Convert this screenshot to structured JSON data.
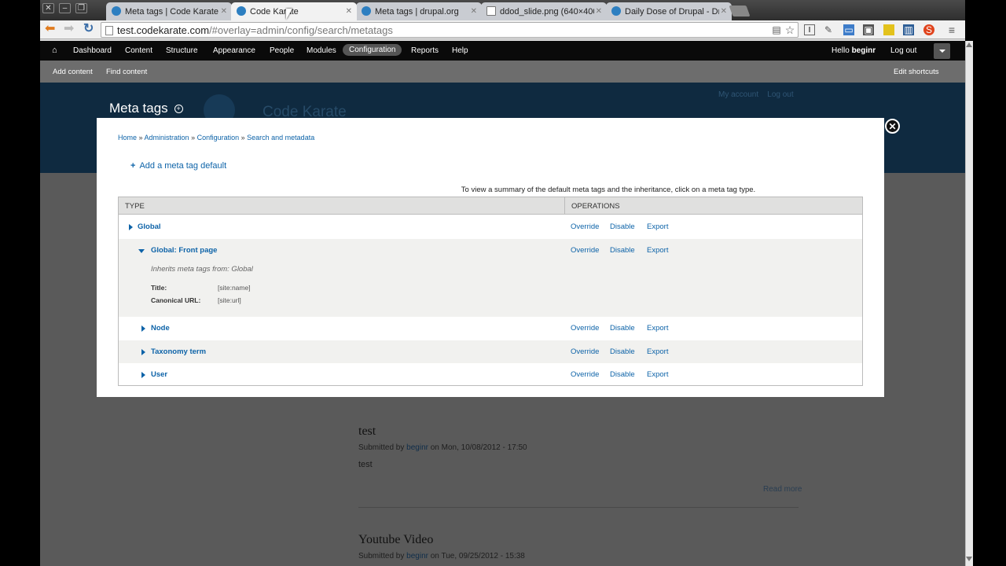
{
  "browser": {
    "tabs": [
      {
        "title": "Meta tags | Code Karate",
        "icon": "drupal-icon"
      },
      {
        "title": "Code Karate",
        "icon": "drupal-icon"
      },
      {
        "title": "Meta tags | drupal.org",
        "icon": "drupal-icon"
      },
      {
        "title": "ddod_slide.png (640×400)",
        "icon": "document-icon"
      },
      {
        "title": "Daily Dose of Drupal - Dru",
        "icon": "drupal-icon"
      }
    ],
    "url_host": "test.codekarate.com",
    "url_path": "/#overlay=admin/config/search/metatags"
  },
  "admin_menu": {
    "items": [
      "Dashboard",
      "Content",
      "Structure",
      "Appearance",
      "People",
      "Modules",
      "Configuration",
      "Reports",
      "Help"
    ],
    "active": "Configuration",
    "hello": "Hello ",
    "user": "beginr",
    "logout": "Log out"
  },
  "shortcuts": {
    "add_content": "Add content",
    "find_content": "Find content",
    "edit_shortcuts": "Edit shortcuts"
  },
  "site": {
    "name": "Code Karate",
    "my_account": "My account",
    "log_out": "Log out"
  },
  "overlay": {
    "title": "Meta tags",
    "breadcrumb": [
      "Home",
      "Administration",
      "Configuration",
      "Search and metadata"
    ],
    "add_link": "Add a meta tag default",
    "summary": "To view a summary of the default meta tags and the inheritance, click on a meta tag type.",
    "col_type": "TYPE",
    "col_ops": "OPERATIONS",
    "ops": {
      "override": "Override",
      "disable": "Disable",
      "export": "Export"
    },
    "rows": [
      {
        "name": "Global",
        "expanded": false
      },
      {
        "name": "Global: Front page",
        "expanded": true,
        "inherits": "Inherits meta tags from: Global",
        "fields": [
          {
            "label": "Title:",
            "value": "[site:name]"
          },
          {
            "label": "Canonical URL:",
            "value": "[site:url]"
          }
        ]
      },
      {
        "name": "Node",
        "expanded": false
      },
      {
        "name": "Taxonomy term",
        "expanded": false
      },
      {
        "name": "User",
        "expanded": false
      }
    ]
  },
  "posts": [
    {
      "title": "test",
      "submitted_by": "Submitted by ",
      "author": "beginr",
      "date": " on Mon, 10/08/2012 - 17:50",
      "body": "test",
      "read_more": "Read more"
    },
    {
      "title": "Youtube Video",
      "submitted_by": "Submitted by ",
      "author": "beginr",
      "date": " on Tue, 09/25/2012 - 15:38"
    }
  ]
}
